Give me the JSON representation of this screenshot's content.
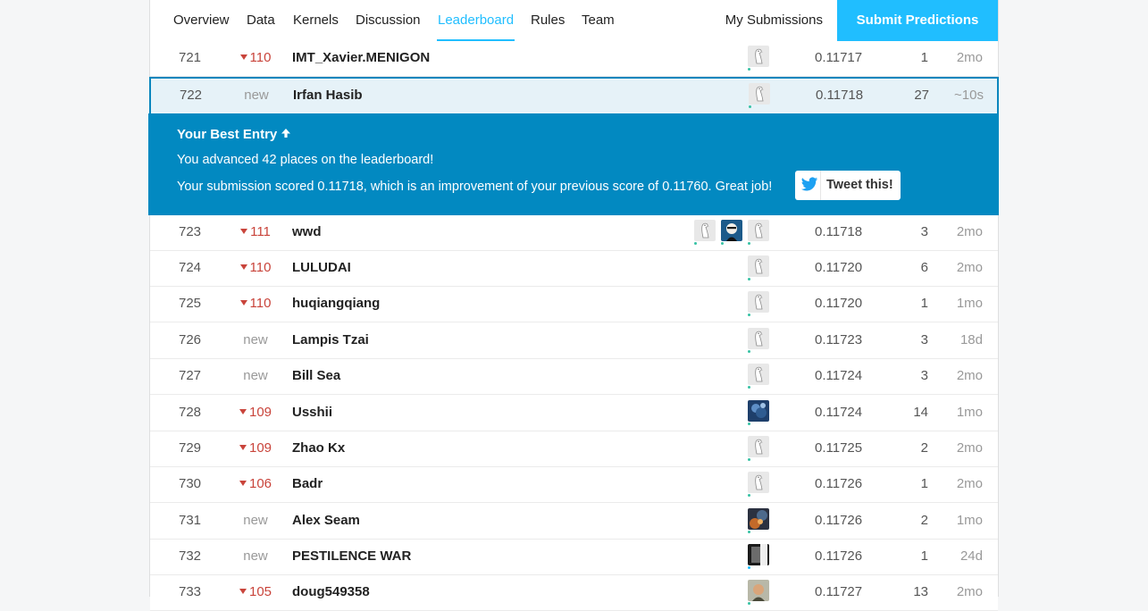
{
  "nav": {
    "tabs": [
      {
        "label": "Overview",
        "active": false
      },
      {
        "label": "Data",
        "active": false
      },
      {
        "label": "Kernels",
        "active": false
      },
      {
        "label": "Discussion",
        "active": false
      },
      {
        "label": "Leaderboard",
        "active": true
      },
      {
        "label": "Rules",
        "active": false
      },
      {
        "label": "Team",
        "active": false
      }
    ],
    "my_submissions": "My Submissions",
    "submit_button": "Submit Predictions"
  },
  "colors": {
    "accent": "#20beff",
    "banner": "#0289c1",
    "drop": "#c9443b",
    "online": "#36c2a4"
  },
  "banner": {
    "title": "Your Best Entry",
    "title_icon": "arrow-up-icon",
    "line1": "You advanced 42 places on the leaderboard!",
    "line2": "Your submission scored 0.11718, which is an improvement of your previous score of 0.11760. Great job!",
    "tweet_label": "Tweet this!",
    "tweet_icon": "twitter-icon"
  },
  "rows": [
    {
      "rank": "721",
      "delta": "110",
      "delta_dir": "down",
      "team": "IMT_Xavier.MENIGON",
      "avatars": [
        "default"
      ],
      "score": "0.11717",
      "entries": "1",
      "last": "2mo"
    },
    {
      "rank": "722",
      "delta": "new",
      "delta_dir": "new",
      "team": "Irfan Hasib",
      "avatars": [
        "default"
      ],
      "score": "0.11718",
      "entries": "27",
      "last": "~10s",
      "mine": true
    },
    {
      "rank": "723",
      "delta": "111",
      "delta_dir": "down",
      "team": "wwd",
      "avatars": [
        "default",
        "photo-face",
        "default"
      ],
      "score": "0.11718",
      "entries": "3",
      "last": "2mo"
    },
    {
      "rank": "724",
      "delta": "110",
      "delta_dir": "down",
      "team": "LULUDAI",
      "avatars": [
        "default"
      ],
      "score": "0.11720",
      "entries": "6",
      "last": "2mo"
    },
    {
      "rank": "725",
      "delta": "110",
      "delta_dir": "down",
      "team": "huqiangqiang",
      "avatars": [
        "default"
      ],
      "score": "0.11720",
      "entries": "1",
      "last": "1mo"
    },
    {
      "rank": "726",
      "delta": "new",
      "delta_dir": "new",
      "team": "Lampis Tzai",
      "avatars": [
        "default"
      ],
      "score": "0.11723",
      "entries": "3",
      "last": "18d"
    },
    {
      "rank": "727",
      "delta": "new",
      "delta_dir": "new",
      "team": "Bill Sea",
      "avatars": [
        "default"
      ],
      "score": "0.11724",
      "entries": "3",
      "last": "2mo"
    },
    {
      "rank": "728",
      "delta": "109",
      "delta_dir": "down",
      "team": "Usshii",
      "avatars": [
        "photo-blue"
      ],
      "score": "0.11724",
      "entries": "14",
      "last": "1mo"
    },
    {
      "rank": "729",
      "delta": "109",
      "delta_dir": "down",
      "team": "Zhao Kx",
      "avatars": [
        "default"
      ],
      "score": "0.11725",
      "entries": "2",
      "last": "2mo"
    },
    {
      "rank": "730",
      "delta": "106",
      "delta_dir": "down",
      "team": "Badr",
      "avatars": [
        "default"
      ],
      "score": "0.11726",
      "entries": "1",
      "last": "2mo"
    },
    {
      "rank": "731",
      "delta": "new",
      "delta_dir": "new",
      "team": "Alex Seam",
      "avatars": [
        "photo-fire"
      ],
      "score": "0.11726",
      "entries": "2",
      "last": "1mo"
    },
    {
      "rank": "732",
      "delta": "new",
      "delta_dir": "new",
      "team": "PESTILENCE WAR",
      "avatars": [
        "photo-dark"
      ],
      "score": "0.11726",
      "entries": "1",
      "last": "24d"
    },
    {
      "rank": "733",
      "delta": "105",
      "delta_dir": "down",
      "team": "doug549358",
      "avatars": [
        "photo-person"
      ],
      "score": "0.11727",
      "entries": "13",
      "last": "2mo"
    }
  ]
}
